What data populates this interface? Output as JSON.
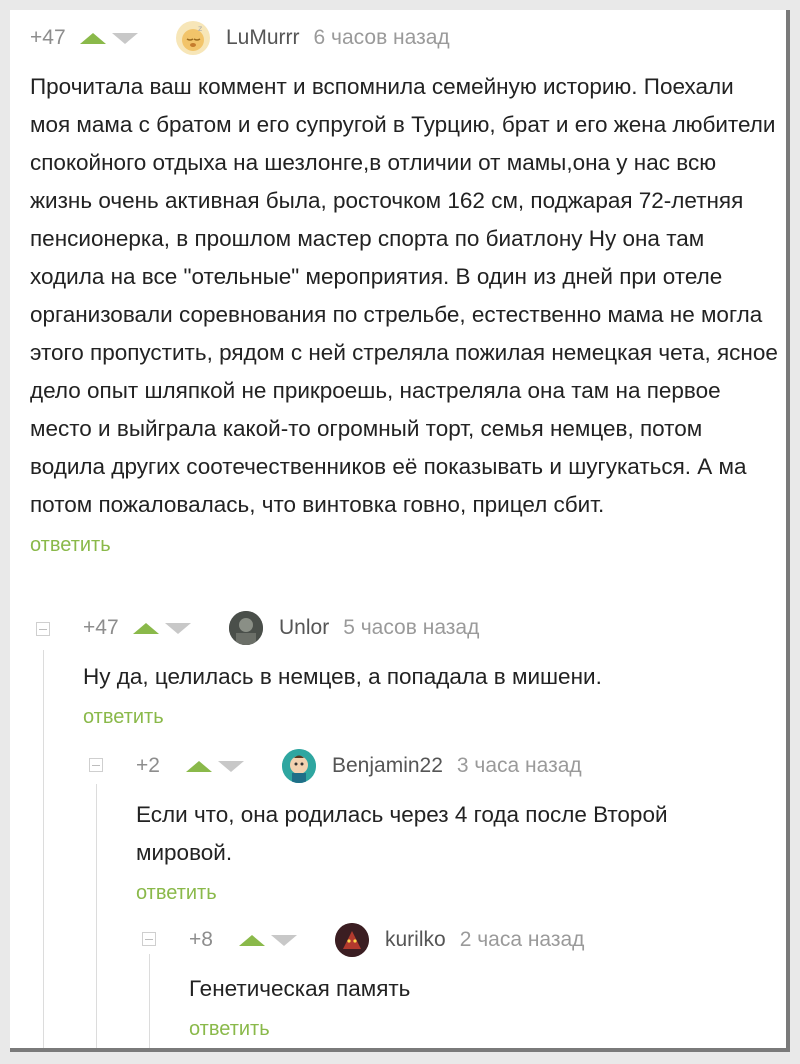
{
  "comments": [
    {
      "rating": "+47",
      "username": "LuMurrr",
      "time": "6 часов назад",
      "avatar_icon": "sleeping-face-icon",
      "text": "Прочитала ваш коммент и вспомнила семейную историю. Поехали моя мама с братом и его супругой в Турцию, брат и его жена любители спокойного отдыха на шезлонге,в отличии от мамы,она у нас всю жизнь очень активная была, росточком 162 см, поджарая 72-летняя пенсионерка, в прошлом мастер спорта по биатлону Ну она там ходила на все \"отельные\" мероприятия. В один из дней при отеле организовали соревнования по стрельбе, естественно мама не могла этого пропустить, рядом с ней стреляла пожилая немецкая чета, ясное дело опыт шляпкой не прикроешь, настреляла она там на первое место и выйграла какой-то огромный торт, семья немцев, потом водила других соотечественников её показывать и шугукаться. А ма потом пожаловалась, что винтовка говно, прицел сбит.",
      "reply": "ответить"
    },
    {
      "rating": "+47",
      "username": "Unlor",
      "time": "5 часов назад",
      "avatar_icon": "dark-portrait-icon",
      "text": "Ну да, целилась в немцев, а попадала в мишени.",
      "reply": "ответить"
    },
    {
      "rating": "+2",
      "username": "Benjamin22",
      "time": "3 часа назад",
      "avatar_icon": "cartoon-face-icon",
      "text": "Если что, она родилась через 4 года после Второй мировой.",
      "reply": "ответить"
    },
    {
      "rating": "+8",
      "username": "kurilko",
      "time": "2 часа назад",
      "avatar_icon": "red-creature-icon",
      "text": "Генетическая память",
      "reply": "ответить"
    }
  ],
  "colors": {
    "accent_green": "#8ab94a",
    "meta_gray": "#9a9a9a",
    "text": "#222222"
  }
}
